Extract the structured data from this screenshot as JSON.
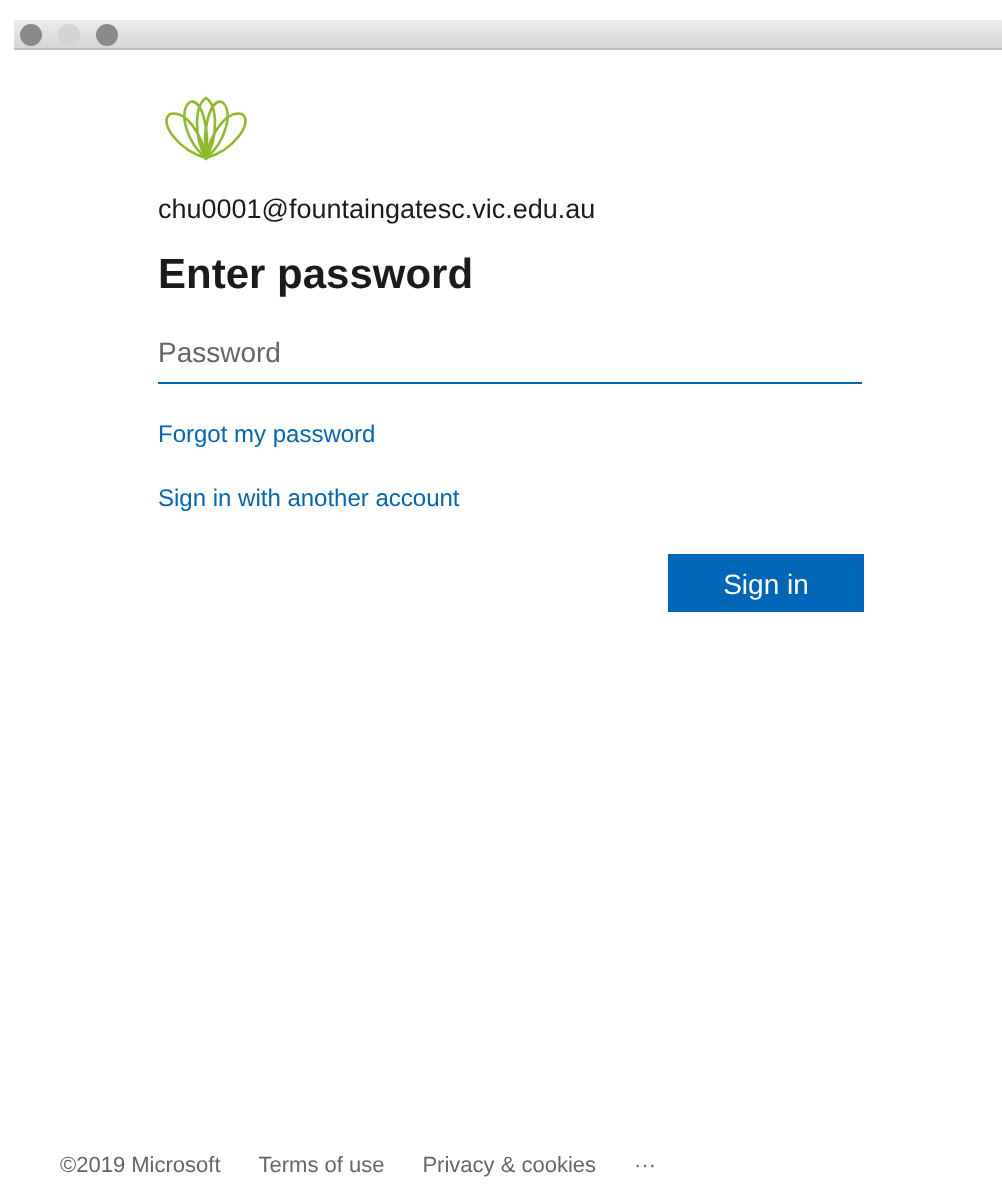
{
  "account": {
    "email": "chu0001@fountaingatesc.vic.edu.au"
  },
  "title": "Enter password",
  "password_field": {
    "placeholder": "Password"
  },
  "links": [
    "Forgot my password",
    "Sign in with another account"
  ],
  "primary_button": "Sign in",
  "footer": [
    "©2019 Microsoft",
    "Terms of use",
    "Privacy & cookies",
    "···"
  ]
}
